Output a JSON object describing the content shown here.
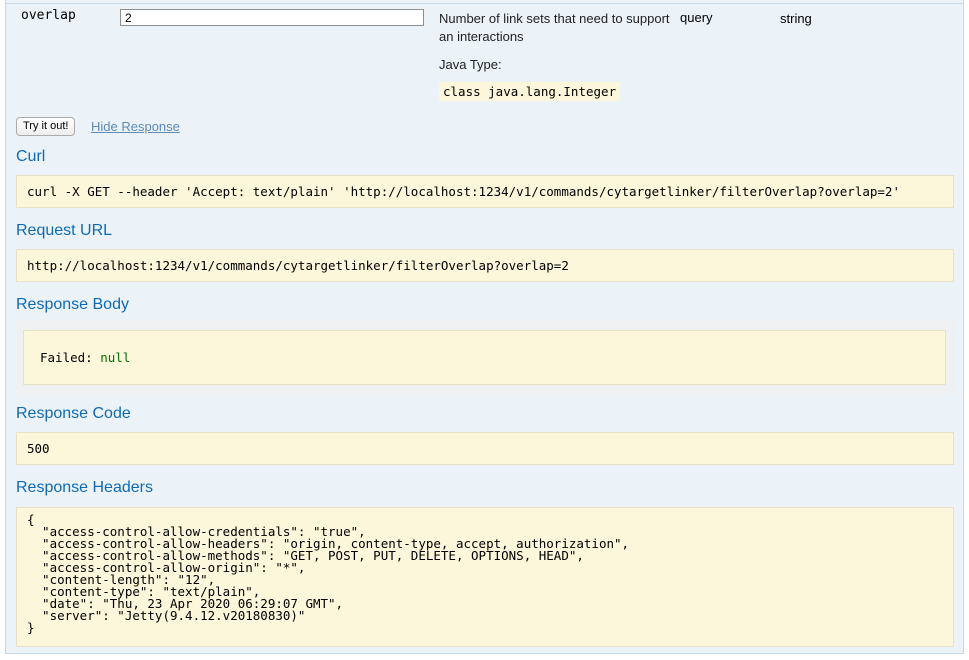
{
  "parameter": {
    "name": "overlap",
    "value": "2",
    "description": "Number of link sets that need to support an interactions",
    "type_label": "Java Type:",
    "java_class": "class java.lang.Integer",
    "param_in": "query",
    "data_type": "string"
  },
  "actions": {
    "try_label": "Try it out!",
    "hide_label": "Hide Response"
  },
  "curl": {
    "title": "Curl",
    "command": "curl -X GET --header 'Accept: text/plain' 'http://localhost:1234/v1/commands/cytargetlinker/filterOverlap?overlap=2'"
  },
  "request_url": {
    "title": "Request URL",
    "url": "http://localhost:1234/v1/commands/cytargetlinker/filterOverlap?overlap=2"
  },
  "response_body": {
    "title": "Response Body",
    "prefix": "Failed: ",
    "value": "null"
  },
  "response_code": {
    "title": "Response Code",
    "code": "500"
  },
  "response_headers": {
    "title": "Response Headers",
    "text": "{\n  \"access-control-allow-credentials\": \"true\",\n  \"access-control-allow-headers\": \"origin, content-type, accept, authorization\",\n  \"access-control-allow-methods\": \"GET, POST, PUT, DELETE, OPTIONS, HEAD\",\n  \"access-control-allow-origin\": \"*\",\n  \"content-length\": \"12\",\n  \"content-type\": \"text/plain\",\n  \"date\": \"Thu, 23 Apr 2020 06:29:07 GMT\",\n  \"server\": \"Jetty(9.4.12.v20180830)\"\n}"
  },
  "colors": {
    "panel_bg": "#ebf3f9",
    "code_bg": "#fcf6db",
    "title_blue": "#0f6ab4",
    "link_blue": "#5e8ab7",
    "null_green": "#007400"
  }
}
